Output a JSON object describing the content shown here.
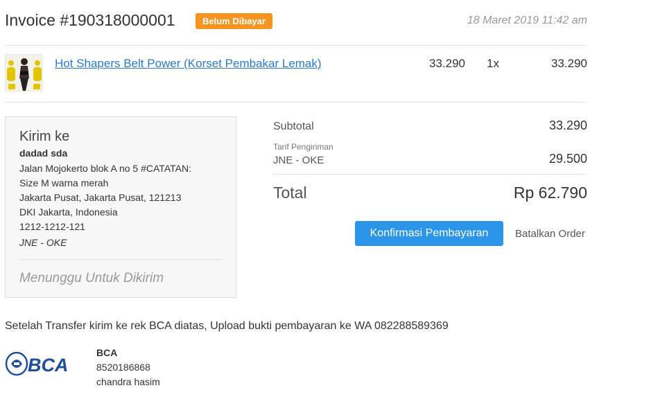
{
  "invoice": {
    "title": "Invoice #190318000001",
    "status_badge": "Belum Dibayar",
    "date": "18 Maret 2019 11:42 am"
  },
  "product": {
    "name": "Hot Shapers Belt Power (Korset Pembakar Lemak)",
    "price": "33.290",
    "qty": "1x",
    "total": "33.290"
  },
  "shipping": {
    "title": "Kirim ke",
    "recipient": "dadad sda",
    "address_lines": [
      "Jalan Mojokerto blok A no 5 #CATATAN:",
      "Size M warna merah",
      "Jakarta Pusat, Jakarta Pusat, 121213",
      "DKI Jakarta, Indonesia",
      "1212-1212-121"
    ],
    "courier": "JNE - OKE",
    "status": "Menunggu Untuk Dikirim"
  },
  "summary": {
    "subtotal_label": "Subtotal",
    "subtotal_value": "33.290",
    "shipping_fee_label": "Tarif Pengiriman",
    "shipping_service": "JNE - OKE",
    "shipping_value": "29.500",
    "total_label": "Total",
    "total_value": "Rp 62.790"
  },
  "actions": {
    "confirm_label": "Konfirmasi Pembayaran",
    "cancel_label": "Batalkan Order"
  },
  "payment": {
    "note": "Setelah Transfer kirim ke rek BCA diatas, Upload bukti pembayaran ke WA 082288589369",
    "bank_logo_text": "BCA",
    "bank_name": "BCA",
    "account_number": "8520186868",
    "account_holder": "chandra hasim"
  },
  "colors": {
    "badge": "#f7931e",
    "link": "#2a7ac7",
    "primary_button": "#2b95e9",
    "bca_blue": "#1f4e9c"
  }
}
